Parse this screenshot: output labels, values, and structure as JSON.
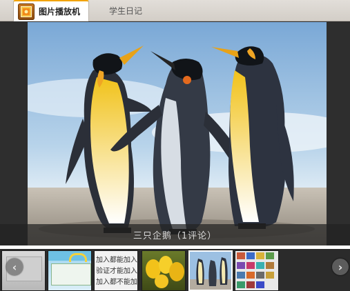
{
  "tabs": [
    {
      "label": "图片播放机",
      "active": true
    },
    {
      "label": "学生日记",
      "active": false
    }
  ],
  "viewer": {
    "caption": "三只企鹅（1评论）",
    "icons": {
      "player": "photo-player-icon",
      "prev": "chevron-left-icon",
      "next": "chevron-right-icon"
    }
  },
  "filmstrip": {
    "thumbnails": [
      {
        "name": "thumb-1",
        "text": ""
      },
      {
        "name": "thumb-2",
        "text": ""
      },
      {
        "name": "thumb-3",
        "lines": [
          "加入都能加入",
          "验证才能加入",
          "加入都不能加入"
        ]
      },
      {
        "name": "thumb-4",
        "text": ""
      },
      {
        "name": "thumb-5",
        "text": ""
      },
      {
        "name": "thumb-6",
        "text": ""
      }
    ],
    "selected_index": 4
  },
  "colors": {
    "accent": "#f2a300",
    "viewer_bg": "#2e2e2e",
    "selected_border": "#ffffff"
  }
}
